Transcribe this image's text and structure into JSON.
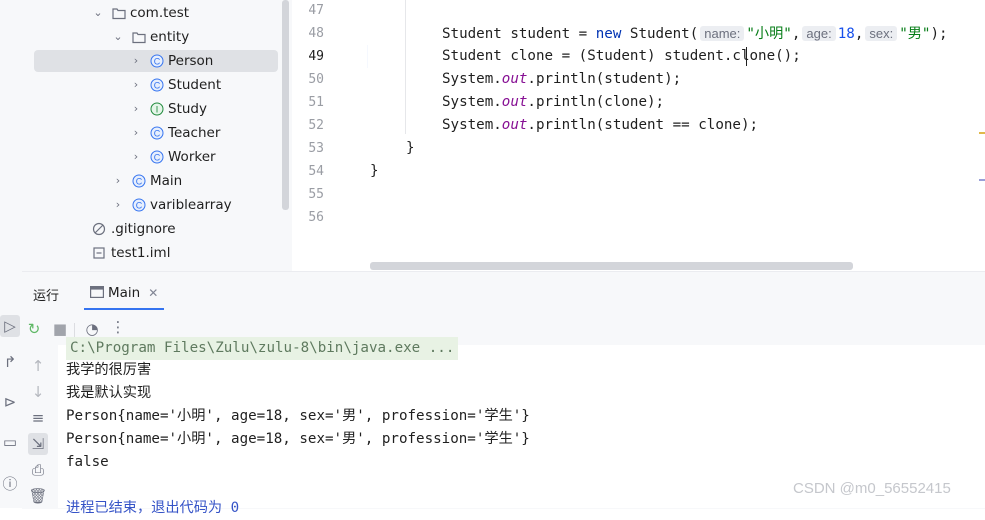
{
  "project_tree": {
    "items": [
      {
        "label": "com.test",
        "icon": "package-icon",
        "expanded": true
      },
      {
        "label": "entity",
        "icon": "package-icon",
        "expanded": true
      },
      {
        "label": "Person",
        "icon": "class-icon",
        "expanded": false,
        "selected": true
      },
      {
        "label": "Student",
        "icon": "class-icon",
        "expanded": false
      },
      {
        "label": "Study",
        "icon": "interface-icon",
        "expanded": false
      },
      {
        "label": "Teacher",
        "icon": "class-icon",
        "expanded": false
      },
      {
        "label": "Worker",
        "icon": "class-icon",
        "expanded": false
      },
      {
        "label": "Main",
        "icon": "class-icon",
        "expanded": false
      },
      {
        "label": "variblearray",
        "icon": "class-icon",
        "expanded": false
      },
      {
        "label": ".gitignore",
        "icon": "ignore-file-icon"
      },
      {
        "label": "test1.iml",
        "icon": "iml-file-icon"
      }
    ]
  },
  "editor": {
    "line_numbers": [
      "47",
      "48",
      "49",
      "50",
      "51",
      "52",
      "53",
      "54",
      "55",
      "56"
    ],
    "current_line": "49",
    "code": {
      "l48_a": "Student student = ",
      "l48_new": "new",
      "l48_b": " Student(",
      "l48_hint_name": "name:",
      "l48_str_name": "\"小明\"",
      "l48_comma1": ",",
      "l48_hint_age": "age:",
      "l48_num_age": "18",
      "l48_comma2": ",",
      "l48_hint_sex": "sex:",
      "l48_str_sex": "\"男\"",
      "l48_end": ");",
      "l49": "Student clone = (Student) student.clone();",
      "l50_a": "System.",
      "l50_out": "out",
      "l50_b": ".println(student);",
      "l51_a": "System.",
      "l51_out": "out",
      "l51_b": ".println(clone);",
      "l52_a": "System.",
      "l52_out": "out",
      "l52_b": ".println(student == clone);",
      "l53": "}",
      "l54": "}"
    }
  },
  "run_panel": {
    "title": "运行",
    "tab_label": "Main",
    "console_lines": [
      "C:\\Program Files\\Zulu\\zulu-8\\bin\\java.exe ...",
      "我学的很厉害",
      "我是默认实现",
      "Person{name='小明', age=18, sex='男', profession='学生'}",
      "Person{name='小明', age=18, sex='男', profession='学生'}",
      "false",
      "",
      "进程已结束，退出代码为 0"
    ]
  },
  "watermark": "CSDN @m0_56552415",
  "colors": {
    "keyword": "#0033b3",
    "field": "#871094",
    "string": "#067d17",
    "number": "#1750eb",
    "selection": "#dfe1e5",
    "accent": "#3574f0"
  }
}
